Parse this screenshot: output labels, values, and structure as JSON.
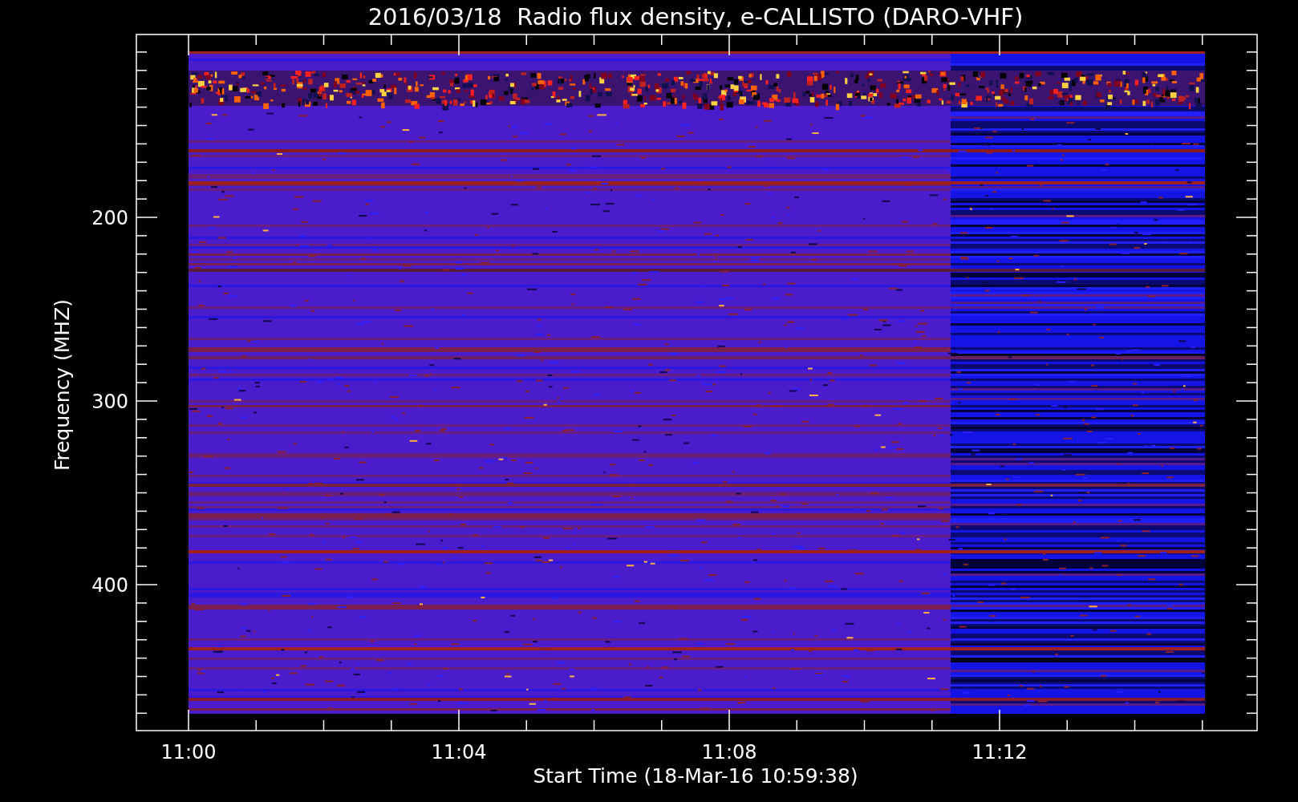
{
  "title": "2016/03/18  Radio flux density, e-CALLISTO (DARO-VHF)",
  "y_axis": {
    "label": "Frequency (MHZ)",
    "ticks": [
      "200",
      "300",
      "400"
    ]
  },
  "x_axis": {
    "label": "Start Time (18-Mar-16 10:59:38)",
    "ticks": [
      "11:00",
      "11:04",
      "11:08",
      "11:12"
    ]
  }
}
